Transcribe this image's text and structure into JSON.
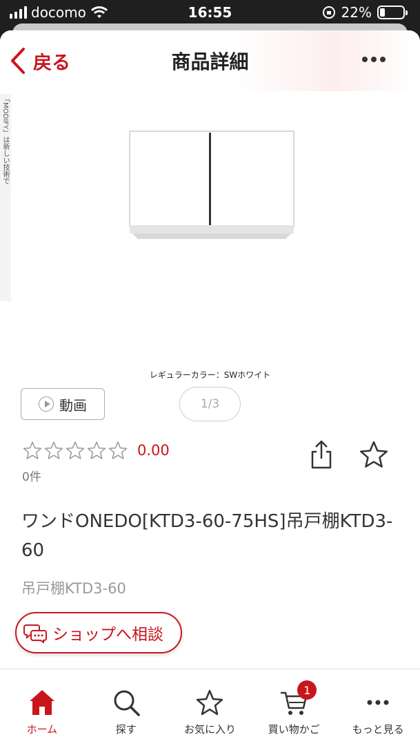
{
  "status_bar": {
    "carrier": "docomo",
    "time": "16:55",
    "battery": "22%",
    "battery_level": 0.22
  },
  "header": {
    "back_label": "戻る",
    "title": "商品詳細"
  },
  "side_banner": {
    "text": "「MODIFY」は新しい技術で"
  },
  "product": {
    "image_caption": "レギュラーカラー：SWホワイト",
    "video_label": "動画",
    "image_pager": "1/3",
    "rating": "0.00",
    "rating_value": 0,
    "rating_max": 5,
    "review_count": "0件",
    "name": "ワンドONEDO[KTD3-60-75HS]吊戸棚KTD3-60",
    "subtitle": "吊戸棚KTD3-60"
  },
  "consult": {
    "label": "ショップへ相談"
  },
  "tabbar": {
    "items": [
      {
        "label": "ホーム",
        "icon": "home-icon",
        "active": true
      },
      {
        "label": "探す",
        "icon": "search-icon"
      },
      {
        "label": "お気に入り",
        "icon": "star-icon"
      },
      {
        "label": "買い物かご",
        "icon": "cart-icon",
        "badge": "1"
      },
      {
        "label": "もっと見る",
        "icon": "more-icon"
      }
    ]
  },
  "colors": {
    "accent": "#c8161d",
    "text": "#333333",
    "muted": "#999999"
  }
}
